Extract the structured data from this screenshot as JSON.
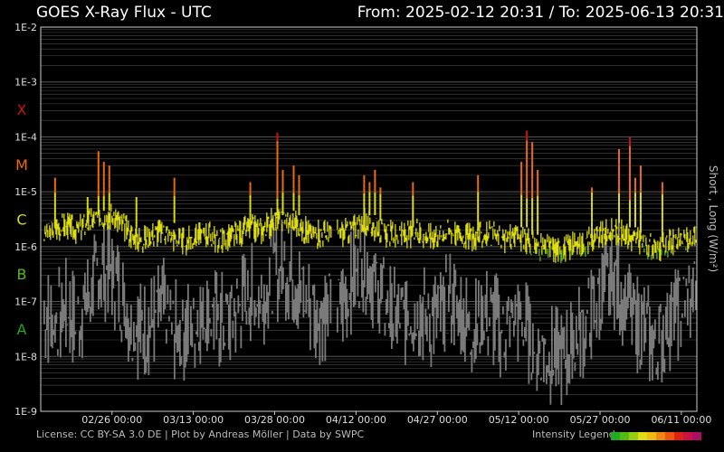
{
  "header": {
    "title": "GOES X-Ray Flux - UTC",
    "range_prefix_from": "From:",
    "from": "2025-02-12 20:31",
    "range_sep": "/",
    "range_prefix_to": "To:",
    "to": "2025-06-13 20:31"
  },
  "footer": {
    "license": "License: CC BY-SA 3.0 DE | Plot by Andreas Möller | Data by SWPC",
    "legend_label": "Intensity Legend"
  },
  "colors": {
    "background": "#000000",
    "frame": "#cccccc",
    "grid": "#4a4a4a",
    "short_channel": "#7a7a7a",
    "class_A": "#1faa1f",
    "class_B": "#55bb22",
    "class_C": "#dddd11",
    "class_M": "#ee6a11",
    "class_X": "#cc1111",
    "legend": [
      "#22aa22",
      "#55bb11",
      "#99cc11",
      "#dddd11",
      "#eebb11",
      "#ee8811",
      "#ee5511",
      "#dd2211",
      "#cc1144",
      "#aa1166"
    ]
  },
  "chart_data": {
    "type": "line",
    "title": "GOES X-Ray Flux - UTC",
    "ylabel": "Short , Long (W/m²)",
    "yscale": "log",
    "ylim": [
      1e-09,
      0.01
    ],
    "y_ticks": [
      "1E-2",
      "1E-3",
      "1E-4",
      "1E-5",
      "1E-6",
      "1E-7",
      "1E-8",
      "1E-9"
    ],
    "flare_classes": [
      {
        "label": "X",
        "value": 0.0001
      },
      {
        "label": "M",
        "value": 1e-05
      },
      {
        "label": "C",
        "value": 1e-06
      },
      {
        "label": "B",
        "value": 1e-07
      },
      {
        "label": "A",
        "value": 1e-08
      }
    ],
    "xlim": [
      "2025-02-12 20:31",
      "2025-06-13 20:31"
    ],
    "x_ticks": [
      "02/26 00:00",
      "03/13 00:00",
      "03/28 00:00",
      "04/12 00:00",
      "04/27 00:00",
      "05/12 00:00",
      "05/27 00:00",
      "06/11 00:00"
    ],
    "gap": [
      "2025-04-07",
      "2025-04-08"
    ],
    "series": [
      {
        "name": "Long",
        "x": [
          "2025-02-13",
          "2025-02-15",
          "2025-02-17",
          "2025-02-19",
          "2025-02-21",
          "2025-02-23",
          "2025-02-25",
          "2025-02-27",
          "2025-03-01",
          "2025-03-03",
          "2025-03-05",
          "2025-03-07",
          "2025-03-09",
          "2025-03-11",
          "2025-03-13",
          "2025-03-15",
          "2025-03-17",
          "2025-03-19",
          "2025-03-21",
          "2025-03-23",
          "2025-03-25",
          "2025-03-27",
          "2025-03-29",
          "2025-03-31",
          "2025-04-02",
          "2025-04-04",
          "2025-04-06",
          "2025-04-09",
          "2025-04-11",
          "2025-04-13",
          "2025-04-15",
          "2025-04-17",
          "2025-04-19",
          "2025-04-21",
          "2025-04-23",
          "2025-04-25",
          "2025-04-27",
          "2025-04-29",
          "2025-05-01",
          "2025-05-03",
          "2025-05-05",
          "2025-05-07",
          "2025-05-09",
          "2025-05-11",
          "2025-05-13",
          "2025-05-15",
          "2025-05-17",
          "2025-05-19",
          "2025-05-21",
          "2025-05-23",
          "2025-05-25",
          "2025-05-27",
          "2025-05-29",
          "2025-05-31",
          "2025-06-02",
          "2025-06-04",
          "2025-06-06",
          "2025-06-08",
          "2025-06-10",
          "2025-06-12",
          "2025-06-13"
        ],
        "values": [
          1.5e-06,
          2e-06,
          2.2e-06,
          1.8e-06,
          2.5e-06,
          3e-06,
          3.5e-06,
          2.5e-06,
          1.5e-06,
          1.2e-06,
          1.5e-06,
          1.8e-06,
          1.3e-06,
          1.1e-06,
          1.4e-06,
          1.6e-06,
          1.2e-06,
          1.3e-06,
          1.6e-06,
          2e-06,
          1.8e-06,
          2.5e-06,
          3e-06,
          2.5e-06,
          1.8e-06,
          1.5e-06,
          1.6e-06,
          1.6e-06,
          2e-06,
          2.5e-06,
          2e-06,
          1.6e-06,
          1.4e-06,
          1.5e-06,
          1.6e-06,
          1.4e-06,
          1.6e-06,
          1.8e-06,
          1.5e-06,
          1.3e-06,
          1.5e-06,
          1.4e-06,
          1.2e-06,
          1.5e-06,
          1.1e-06,
          9e-07,
          8.5e-07,
          8e-07,
          9e-07,
          1e-06,
          1.2e-06,
          1.5e-06,
          1.8e-06,
          1.5e-06,
          1.2e-06,
          1e-06,
          8e-07,
          1e-06,
          1.1e-06,
          1.2e-06,
          1.4e-06
        ]
      },
      {
        "name": "Short",
        "x": [
          "2025-02-13",
          "2025-02-15",
          "2025-02-17",
          "2025-02-19",
          "2025-02-21",
          "2025-02-23",
          "2025-02-25",
          "2025-02-27",
          "2025-03-01",
          "2025-03-03",
          "2025-03-05",
          "2025-03-07",
          "2025-03-09",
          "2025-03-11",
          "2025-03-13",
          "2025-03-15",
          "2025-03-17",
          "2025-03-19",
          "2025-03-21",
          "2025-03-23",
          "2025-03-25",
          "2025-03-27",
          "2025-03-29",
          "2025-03-31",
          "2025-04-02",
          "2025-04-04",
          "2025-04-06",
          "2025-04-09",
          "2025-04-11",
          "2025-04-13",
          "2025-04-15",
          "2025-04-17",
          "2025-04-19",
          "2025-04-21",
          "2025-04-23",
          "2025-04-25",
          "2025-04-27",
          "2025-04-29",
          "2025-05-01",
          "2025-05-03",
          "2025-05-05",
          "2025-05-07",
          "2025-05-09",
          "2025-05-11",
          "2025-05-13",
          "2025-05-15",
          "2025-05-17",
          "2025-05-19",
          "2025-05-21",
          "2025-05-23",
          "2025-05-25",
          "2025-05-27",
          "2025-05-29",
          "2025-05-31",
          "2025-06-02",
          "2025-06-04",
          "2025-06-06",
          "2025-06-08",
          "2025-06-10",
          "2025-06-12",
          "2025-06-13"
        ],
        "values": [
          4e-08,
          3e-08,
          5e-08,
          3e-08,
          8e-08,
          2e-07,
          3e-07,
          1e-07,
          3e-08,
          2e-08,
          3e-08,
          5e-08,
          2e-08,
          2e-08,
          3e-08,
          5e-08,
          3e-08,
          3e-08,
          6e-08,
          1e-07,
          8e-08,
          2e-07,
          3e-07,
          2e-07,
          8e-08,
          4e-08,
          5e-08,
          6e-08,
          2e-07,
          4e-07,
          1.5e-07,
          6e-08,
          3e-08,
          4e-08,
          5e-08,
          3e-08,
          4e-08,
          8e-08,
          4e-08,
          2e-08,
          4e-08,
          3e-08,
          2e-08,
          4e-08,
          2e-08,
          1e-08,
          8e-09,
          6e-09,
          1e-08,
          2e-08,
          4e-08,
          1e-07,
          2e-07,
          8e-08,
          3e-08,
          2e-08,
          1e-08,
          3e-08,
          5e-08,
          8e-08,
          1e-07
        ]
      }
    ],
    "flares": [
      {
        "x": "2025-02-15",
        "peak": 1.8e-05
      },
      {
        "x": "2025-02-21",
        "peak": 8e-06
      },
      {
        "x": "2025-02-23",
        "peak": 5.5e-05
      },
      {
        "x": "2025-02-24",
        "peak": 3.5e-05
      },
      {
        "x": "2025-02-25",
        "peak": 3e-05
      },
      {
        "x": "2025-03-02",
        "peak": 8e-06
      },
      {
        "x": "2025-03-09",
        "peak": 1.8e-05
      },
      {
        "x": "2025-03-23",
        "peak": 1.5e-05
      },
      {
        "x": "2025-03-28",
        "peak": 0.00012
      },
      {
        "x": "2025-03-29",
        "peak": 2.5e-05
      },
      {
        "x": "2025-03-31",
        "peak": 3e-05
      },
      {
        "x": "2025-04-01",
        "peak": 2e-05
      },
      {
        "x": "2025-04-13",
        "peak": 2e-05
      },
      {
        "x": "2025-04-14",
        "peak": 1.5e-05
      },
      {
        "x": "2025-04-15",
        "peak": 2.5e-05
      },
      {
        "x": "2025-04-16",
        "peak": 1.2e-05
      },
      {
        "x": "2025-04-22",
        "peak": 1.5e-05
      },
      {
        "x": "2025-05-04",
        "peak": 2e-05
      },
      {
        "x": "2025-05-12",
        "peak": 3.5e-05
      },
      {
        "x": "2025-05-13",
        "peak": 0.00013
      },
      {
        "x": "2025-05-14",
        "peak": 8e-05
      },
      {
        "x": "2025-05-15",
        "peak": 2.5e-05
      },
      {
        "x": "2025-05-25",
        "peak": 1.2e-05
      },
      {
        "x": "2025-05-30",
        "peak": 6e-05
      },
      {
        "x": "2025-06-01",
        "peak": 0.0001
      },
      {
        "x": "2025-06-02",
        "peak": 1.8e-05
      },
      {
        "x": "2025-06-03",
        "peak": 3e-05
      },
      {
        "x": "2025-06-07",
        "peak": 1.5e-05
      }
    ]
  }
}
